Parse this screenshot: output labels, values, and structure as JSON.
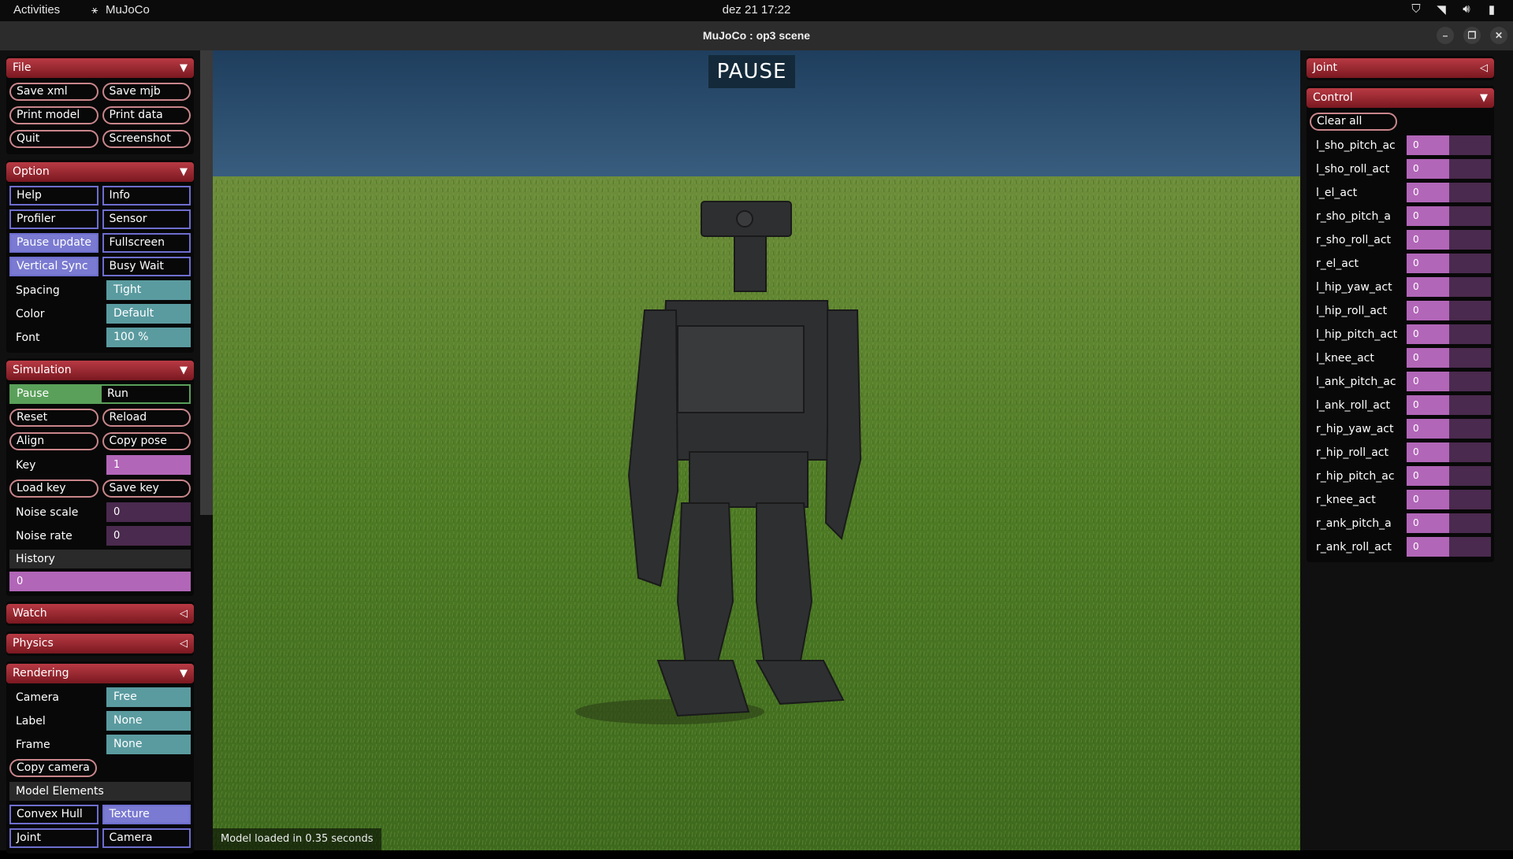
{
  "topbar": {
    "activities": "Activities",
    "app_name": "MuJoCo",
    "clock": "dez 21  17:22"
  },
  "window": {
    "title": "MuJoCo : op3 scene"
  },
  "overlay": {
    "pause_label": "PAUSE",
    "status": "Model loaded in 0.35 seconds"
  },
  "file": {
    "header": "File",
    "buttons": [
      "Save xml",
      "Save mjb",
      "Print model",
      "Print data",
      "Quit",
      "Screenshot"
    ]
  },
  "option": {
    "header": "Option",
    "toggles": [
      {
        "label": "Help",
        "on": false
      },
      {
        "label": "Info",
        "on": false
      },
      {
        "label": "Profiler",
        "on": false
      },
      {
        "label": "Sensor",
        "on": false
      },
      {
        "label": "Pause update",
        "on": true
      },
      {
        "label": "Fullscreen",
        "on": false
      },
      {
        "label": "Vertical Sync",
        "on": true
      },
      {
        "label": "Busy Wait",
        "on": false
      }
    ],
    "spacing_label": "Spacing",
    "spacing_value": "Tight",
    "color_label": "Color",
    "color_value": "Default",
    "font_label": "Font",
    "font_value": "100 %"
  },
  "simulation": {
    "header": "Simulation",
    "pause": "Pause",
    "run": "Run",
    "reset": "Reset",
    "reload": "Reload",
    "align": "Align",
    "copy_pose": "Copy pose",
    "key_label": "Key",
    "key_value": "1",
    "load_key": "Load key",
    "save_key": "Save key",
    "noise_scale_label": "Noise scale",
    "noise_scale_value": "0",
    "noise_rate_label": "Noise rate",
    "noise_rate_value": "0",
    "history_label": "History",
    "history_value": "0"
  },
  "watch": {
    "header": "Watch"
  },
  "physics": {
    "header": "Physics"
  },
  "rendering": {
    "header": "Rendering",
    "camera_label": "Camera",
    "camera_value": "Free",
    "label_label": "Label",
    "label_value": "None",
    "frame_label": "Frame",
    "frame_value": "None",
    "copy_camera": "Copy camera",
    "model_elements": "Model Elements",
    "convex_hull": "Convex Hull",
    "texture": "Texture",
    "joint": "Joint",
    "camera": "Camera"
  },
  "joint_panel": {
    "header": "Joint"
  },
  "control": {
    "header": "Control",
    "clear_all": "Clear all",
    "actuators": [
      {
        "name": "l_sho_pitch_ac",
        "value": "0"
      },
      {
        "name": "l_sho_roll_act",
        "value": "0"
      },
      {
        "name": "l_el_act",
        "value": "0"
      },
      {
        "name": "r_sho_pitch_a",
        "value": "0"
      },
      {
        "name": "r_sho_roll_act",
        "value": "0"
      },
      {
        "name": "r_el_act",
        "value": "0"
      },
      {
        "name": "l_hip_yaw_act",
        "value": "0"
      },
      {
        "name": "l_hip_roll_act",
        "value": "0"
      },
      {
        "name": "l_hip_pitch_act",
        "value": "0"
      },
      {
        "name": "l_knee_act",
        "value": "0"
      },
      {
        "name": "l_ank_pitch_ac",
        "value": "0"
      },
      {
        "name": "l_ank_roll_act",
        "value": "0"
      },
      {
        "name": "r_hip_yaw_act",
        "value": "0"
      },
      {
        "name": "r_hip_roll_act",
        "value": "0"
      },
      {
        "name": "r_hip_pitch_ac",
        "value": "0"
      },
      {
        "name": "r_knee_act",
        "value": "0"
      },
      {
        "name": "r_ank_pitch_a",
        "value": "0"
      },
      {
        "name": "r_ank_roll_act",
        "value": "0"
      }
    ]
  },
  "colors": {
    "section_header": "#b83a44",
    "button_border": "#c9868b",
    "toggle_on": "#7a7ad2",
    "select_bg": "#5a9ba0",
    "edit_bg": "#b266b8",
    "radio_on": "#5aa05a",
    "sky": "#2d4d6e",
    "grass": "#4f7a2a"
  }
}
